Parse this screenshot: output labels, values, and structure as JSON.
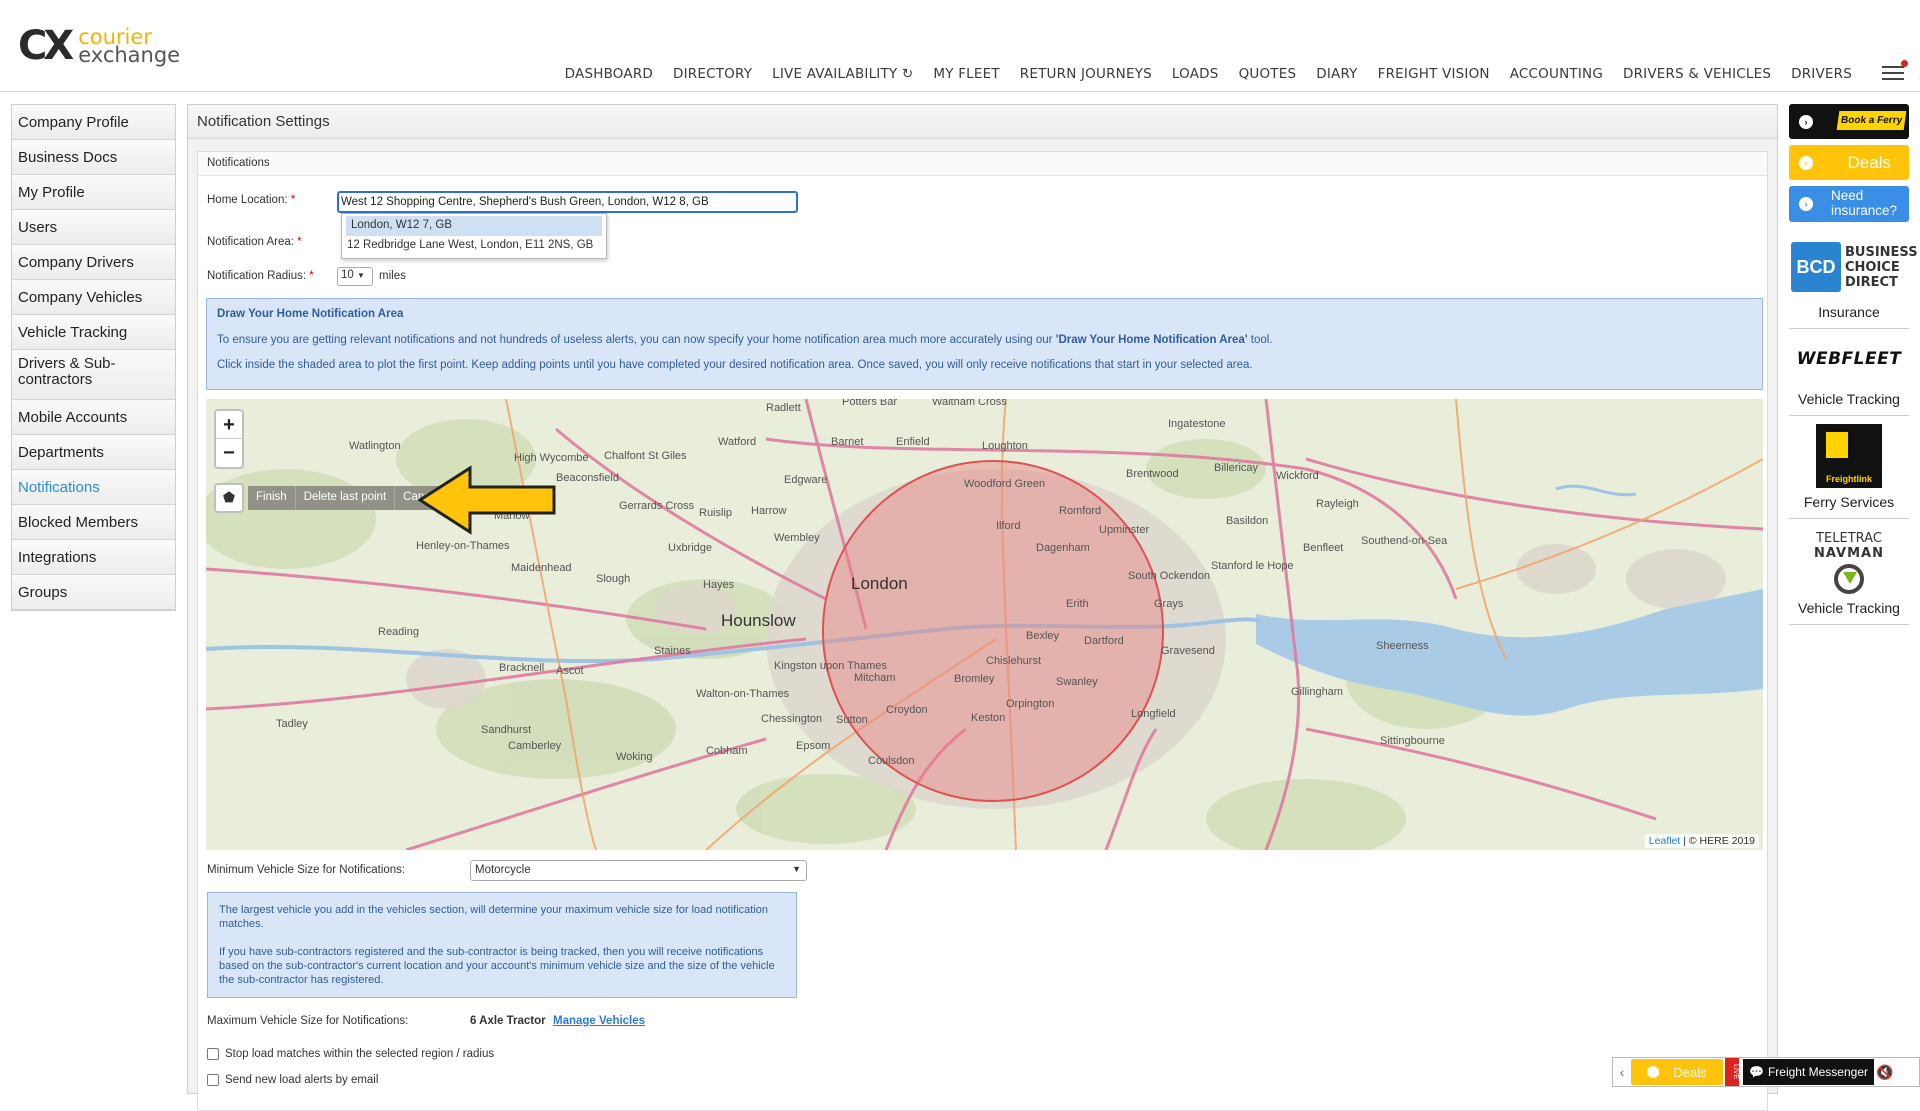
{
  "logo": {
    "mark": "CX",
    "line1": "courier",
    "line2": "exchange"
  },
  "nav": {
    "items": [
      "DASHBOARD",
      "DIRECTORY",
      "LIVE AVAILABILITY",
      "MY FLEET",
      "RETURN JOURNEYS",
      "LOADS",
      "QUOTES",
      "DIARY",
      "FREIGHT VISION",
      "ACCOUNTING",
      "DRIVERS & VEHICLES",
      "DRIVERS"
    ],
    "live_icon": "refresh-icon",
    "menu_icon": "hamburger-icon"
  },
  "sidebar": {
    "items": [
      {
        "label": "Company Profile"
      },
      {
        "label": "Business Docs"
      },
      {
        "label": "My Profile"
      },
      {
        "label": "Users"
      },
      {
        "label": "Company Drivers"
      },
      {
        "label": "Company Vehicles"
      },
      {
        "label": "Vehicle Tracking"
      },
      {
        "label": "Drivers & Sub-contractors"
      },
      {
        "label": "Mobile Accounts"
      },
      {
        "label": "Departments"
      },
      {
        "label": "Notifications",
        "active": true
      },
      {
        "label": "Blocked Members"
      },
      {
        "label": "Integrations"
      },
      {
        "label": "Groups"
      }
    ]
  },
  "main": {
    "title": "Notification Settings",
    "section": "Notifications",
    "home_location": {
      "label": "Home Location:",
      "required": "*",
      "value": "West 12 Shopping Centre, Shepherd's Bush Green, London, W12 8, GB"
    },
    "suggestions": [
      "London, W12 7, GB",
      "12 Redbridge Lane West, London, E11 2NS, GB"
    ],
    "notification_area": {
      "label": "Notification Area:",
      "required": "*"
    },
    "notification_radius": {
      "label": "Notification Radius:",
      "required": "*",
      "value": "10",
      "unit": "miles"
    },
    "info": {
      "title": "Draw Your Home Notification Area",
      "p1_pre": "To ensure you are getting relevant notifications and not hundreds of useless alerts, you can now specify your home notification area much more accurately using our ",
      "p1_bold": "'Draw Your Home Notification Area'",
      "p1_post": " tool.",
      "p2": "Click inside the shaded area to plot the first point. Keep adding points until you have completed your desired notification area. Once saved, you will only receive notifications that start in your selected area."
    },
    "map": {
      "zoom_in": "+",
      "zoom_out": "−",
      "draw_actions": [
        "Finish",
        "Delete last point",
        "Cancel"
      ],
      "attribution_link": "Leaflet",
      "attribution_text": "| © HERE 2019",
      "places": [
        {
          "name": "London",
          "big": true
        },
        {
          "name": "Hounslow",
          "big": true
        },
        {
          "name": "Harrow"
        },
        {
          "name": "Wembley"
        },
        {
          "name": "Edgware"
        },
        {
          "name": "Barnet"
        },
        {
          "name": "Enfield"
        },
        {
          "name": "Watford"
        },
        {
          "name": "Slough"
        },
        {
          "name": "Reading"
        },
        {
          "name": "Maidenhead"
        },
        {
          "name": "Bromley"
        },
        {
          "name": "Croydon"
        },
        {
          "name": "Romford"
        },
        {
          "name": "Ilford"
        },
        {
          "name": "Dagenham"
        },
        {
          "name": "Bexley"
        },
        {
          "name": "Dartford"
        },
        {
          "name": "Erith"
        },
        {
          "name": "Grays"
        },
        {
          "name": "Basildon"
        },
        {
          "name": "Brentwood"
        },
        {
          "name": "Billericay"
        },
        {
          "name": "Southend-on-Sea"
        },
        {
          "name": "Gravesend"
        },
        {
          "name": "Sheerness"
        },
        {
          "name": "Gillingham"
        },
        {
          "name": "Sittingbourne"
        },
        {
          "name": "Staines"
        },
        {
          "name": "Kingston upon Thames"
        },
        {
          "name": "Mitcham"
        },
        {
          "name": "Sutton"
        },
        {
          "name": "Epsom"
        },
        {
          "name": "Bracknell"
        },
        {
          "name": "Woking"
        },
        {
          "name": "Camberley"
        },
        {
          "name": "Marlow"
        },
        {
          "name": "High Wycombe"
        },
        {
          "name": "Beaconsfield"
        },
        {
          "name": "Uxbridge"
        },
        {
          "name": "Hayes"
        },
        {
          "name": "Chislehurst"
        },
        {
          "name": "Orpington"
        },
        {
          "name": "Swanley"
        },
        {
          "name": "Woodford Green"
        },
        {
          "name": "Loughton"
        },
        {
          "name": "Ingatestone"
        },
        {
          "name": "Wickford"
        },
        {
          "name": "Rayleigh"
        },
        {
          "name": "Benfleet"
        },
        {
          "name": "Upminster"
        },
        {
          "name": "Tadley"
        },
        {
          "name": "Sandhurst"
        },
        {
          "name": "Ascot"
        },
        {
          "name": "Cobham"
        },
        {
          "name": "Coulsdon"
        },
        {
          "name": "Chessington"
        },
        {
          "name": "Walton-on-Thames"
        },
        {
          "name": "Watlington"
        },
        {
          "name": "Henley-on-Thames"
        },
        {
          "name": "Radlett"
        },
        {
          "name": "Potters Bar"
        },
        {
          "name": "Waltham Cross"
        },
        {
          "name": "Ruislip"
        },
        {
          "name": "Gerrards Cross"
        },
        {
          "name": "Chalfont St Giles"
        },
        {
          "name": "Keston"
        },
        {
          "name": "Longfield"
        },
        {
          "name": "South Ockendon"
        },
        {
          "name": "Stanford le Hope"
        }
      ]
    },
    "min_vehicle": {
      "label": "Minimum Vehicle Size for Notifications:",
      "value": "Motorcycle"
    },
    "note": {
      "p1": "The largest vehicle you add in the vehicles section, will determine your maximum vehicle size for load notification matches.",
      "p2": "If you have sub-contractors registered and the sub-contractor is being tracked, then you will receive notifications based on the sub-contractor's current location and your account's minimum vehicle size and the size of the vehicle the sub-contractor has registered."
    },
    "max_vehicle": {
      "label": "Maximum Vehicle Size for Notifications:",
      "value": "6 Axle Tractor",
      "link": "Manage Vehicles"
    },
    "checkboxes": [
      "Stop load matches within the selected region / radius",
      "Send new load alerts by email"
    ]
  },
  "ads": {
    "ferry": "Book a Ferry",
    "deals": "Deals",
    "insurance_btn": "Need insurance?",
    "bcd_logo": "BCD",
    "bcd_name": "BUSINESS CHOICE DIRECT",
    "bcd_caption": "Insurance",
    "webfleet_logo": "WEBFLEET",
    "webfleet_caption": "Vehicle Tracking",
    "freightlink_logo": "Freightlink",
    "freightlink_caption": "Ferry Services",
    "teletrac_l1": "TELETRAC",
    "teletrac_l2": "NAVMAN",
    "teletrac_caption": "Vehicle Tracking"
  },
  "messenger": {
    "deals": "Deals",
    "live": "LIVE",
    "label": "Freight Messenger"
  },
  "colors": {
    "accent": "#2a8fd6",
    "brand_yellow": "#f4b400",
    "circle_fill": "#e88080",
    "circle_stroke": "#e05050",
    "arrow": "#ffc40a"
  }
}
